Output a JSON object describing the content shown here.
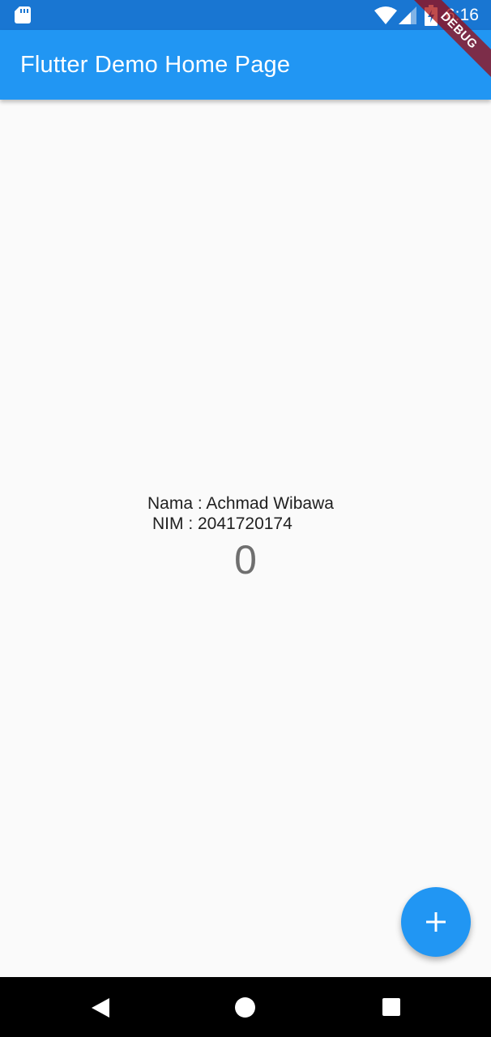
{
  "status_bar": {
    "time": "6:16",
    "icons": [
      "sd-card-icon",
      "wifi-icon",
      "cell-signal-icon",
      "battery-charging-icon"
    ]
  },
  "debug_banner": {
    "label": "DEBUG"
  },
  "app_bar": {
    "title": "Flutter Demo Home Page",
    "color": "#2196f3"
  },
  "main": {
    "name_line": "Nama : Achmad Wibawa",
    "nim_line": "NIM : 2041720174",
    "counter_value": "0"
  },
  "fab": {
    "icon": "plus-icon",
    "color": "#2196f3"
  },
  "nav_bar": {
    "icons": [
      "back-icon",
      "home-icon",
      "recents-icon"
    ]
  },
  "colors": {
    "status_bar": "#1976d2",
    "background": "#fafafa",
    "accent": "#2196f3"
  }
}
